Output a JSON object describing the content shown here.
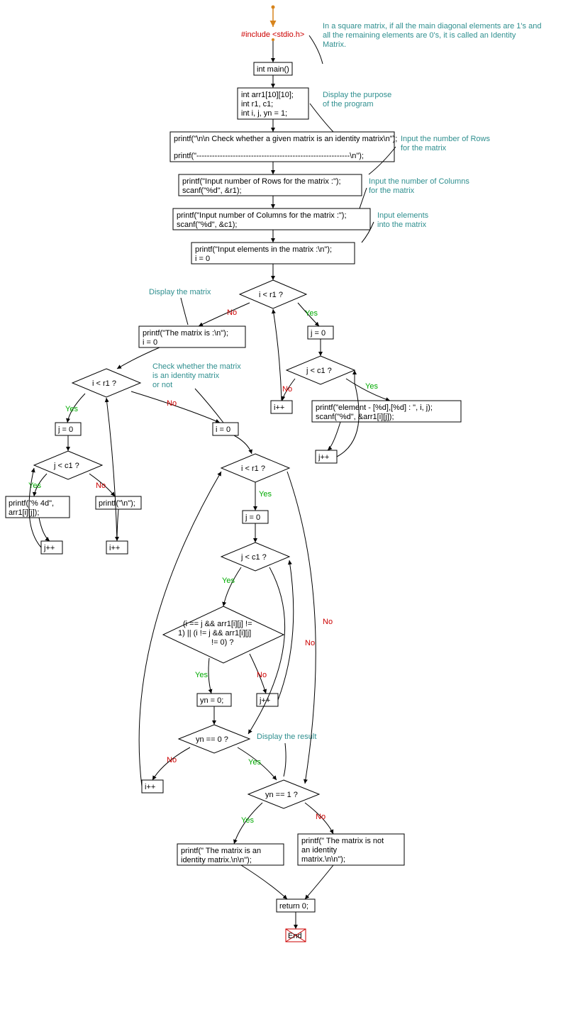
{
  "include": "#include <stdio.h>",
  "main_decl": "int main()",
  "decls_l1": "int arr1[10][10];",
  "decls_l2": "int r1, c1;",
  "decls_l3": "int i, j, yn = 1;",
  "print_header_l1": "printf(\"\\n\\n Check whether a given matrix is an identity matrix\\n\");",
  "print_header_l2": "printf(\"-----------------------------------------------------------\\n\");",
  "input_rows_l1": "printf(\"Input number of Rows for the matrix :\");",
  "input_rows_l2": "scanf(\"%d\", &r1);",
  "input_cols_l1": "printf(\"Input number of Columns for the matrix :\");",
  "input_cols_l2": "scanf(\"%d\", &c1);",
  "input_elems_l1": "printf(\"Input elements in the matrix :\\n\");",
  "input_elems_l2": "i = 0",
  "cond_i_lt_r1": "i < r1 ?",
  "j_eq_0": "j = 0",
  "cond_j_lt_c1": "j < c1 ?",
  "read_elem_l1": "printf(\"element - [%d],[%d] : \", i, j);",
  "read_elem_l2": "scanf(\"%d\", &arr1[i][j]);",
  "jpp": "j++",
  "ipp": "i++",
  "disp_matrix_l1": "printf(\"The matrix is :\\n\");",
  "disp_matrix_l2": "i = 0",
  "print_cell_l1": "printf(\"% 4d\",",
  "print_cell_l2": "arr1[i][j]);",
  "print_nl": "printf(\"\\n\");",
  "i_eq_0": "i = 0",
  "cond_identity_l1": "(i == j && arr1[i][j] !=",
  "cond_identity_l2": "1) || (i != j && arr1[i][j]",
  "cond_identity_l3": "!= 0) ?",
  "yn_eq_0": "yn = 0;",
  "cond_yn_eq_0": "yn == 0 ?",
  "cond_yn_eq_1": "yn == 1 ?",
  "res_yes_l1": "printf(\" The matrix is an",
  "res_yes_l2": "identity matrix.\\n\\n\");",
  "res_no_l1": "printf(\" The matrix is not",
  "res_no_l2": "an identity",
  "res_no_l3": "matrix.\\n\\n\");",
  "return0": "return 0;",
  "end": "End",
  "yes": "Yes",
  "no": "No",
  "c_top": "In a square matrix, if all the main diagonal elements are 1's and all the remaining elements are 0's, it is called an Identity Matrix.",
  "c_top_l1": "In a square matrix, if all the main diagonal elements are 1's and",
  "c_top_l2": "all the remaining elements are 0's, it is called an Identity",
  "c_top_l3": "Matrix.",
  "c_purpose_l1": "Display the purpose",
  "c_purpose_l2": "of the program",
  "c_rows_l1": "Input the number of Rows",
  "c_rows_l2": "for the matrix",
  "c_cols_l1": "Input the number of Columns",
  "c_cols_l2": "for the matrix",
  "c_elems_l1": "Input elements",
  "c_elems_l2": "into the matrix",
  "c_disp": "Display the matrix",
  "c_check_l1": "Check whether the matrix",
  "c_check_l2": "is an identity matrix",
  "c_check_l3": "or not",
  "c_result": "Display the result",
  "chart_data": {
    "type": "flowchart",
    "nodes": [
      {
        "id": "start_arrow",
        "type": "start"
      },
      {
        "id": "include",
        "type": "text",
        "text": "#include <stdio.h>"
      },
      {
        "id": "main",
        "type": "process",
        "text": "int main()"
      },
      {
        "id": "decls",
        "type": "process",
        "lines": [
          "int arr1[10][10];",
          "int r1, c1;",
          "int i, j, yn = 1;"
        ]
      },
      {
        "id": "print_header",
        "type": "process",
        "lines": [
          "printf(\"\\n\\n Check whether a given matrix is an identity matrix :\\n\");",
          "printf(\"-----------------------------------------------------------\\n\");"
        ]
      },
      {
        "id": "input_rows",
        "type": "process",
        "lines": [
          "printf(\"Input number of Rows for the matrix :\");",
          "scanf(\"%d\", &r1);"
        ]
      },
      {
        "id": "input_cols",
        "type": "process",
        "lines": [
          "printf(\"Input number of Columns for the matrix :\");",
          "scanf(\"%d\", &c1);"
        ]
      },
      {
        "id": "input_elems_init",
        "type": "process",
        "lines": [
          "printf(\"Input elements in the matrix :\\n\");",
          "i = 0"
        ]
      },
      {
        "id": "cond_i_r1_input",
        "type": "decision",
        "text": "i < r1 ?"
      },
      {
        "id": "j0_input",
        "type": "process",
        "text": "j = 0"
      },
      {
        "id": "cond_j_c1_input",
        "type": "decision",
        "text": "j < c1 ?"
      },
      {
        "id": "read_elem",
        "type": "process",
        "lines": [
          "printf(\"element - [%d],[%d] : \", i, j);",
          "scanf(\"%d\", &arr1[i][j]);"
        ]
      },
      {
        "id": "jpp_input",
        "type": "process",
        "text": "j++"
      },
      {
        "id": "ipp_input",
        "type": "process",
        "text": "i++"
      },
      {
        "id": "disp_init",
        "type": "process",
        "lines": [
          "printf(\"The matrix is :\\n\");",
          "i = 0"
        ]
      },
      {
        "id": "cond_i_r1_disp",
        "type": "decision",
        "text": "i < r1 ?"
      },
      {
        "id": "j0_disp",
        "type": "process",
        "text": "j = 0"
      },
      {
        "id": "cond_j_c1_disp",
        "type": "decision",
        "text": "j < c1 ?"
      },
      {
        "id": "print_cell",
        "type": "process",
        "lines": [
          "printf(\"% 4d\",",
          "arr1[i][j]);"
        ]
      },
      {
        "id": "jpp_disp",
        "type": "process",
        "text": "j++"
      },
      {
        "id": "print_nl",
        "type": "process",
        "text": "printf(\"\\n\");"
      },
      {
        "id": "ipp_disp",
        "type": "process",
        "text": "i++"
      },
      {
        "id": "i0_check",
        "type": "process",
        "text": "i = 0"
      },
      {
        "id": "cond_i_r1_check",
        "type": "decision",
        "text": "i < r1 ?"
      },
      {
        "id": "j0_check",
        "type": "process",
        "text": "j = 0"
      },
      {
        "id": "cond_j_c1_check",
        "type": "decision",
        "text": "j < c1 ?"
      },
      {
        "id": "cond_identity",
        "type": "decision",
        "text": "(i == j && arr1[i][j] != 1) || (i != j && arr1[i][j] != 0) ?"
      },
      {
        "id": "yn0",
        "type": "process",
        "text": "yn = 0;"
      },
      {
        "id": "jpp_check",
        "type": "process",
        "text": "j++"
      },
      {
        "id": "cond_yn0",
        "type": "decision",
        "text": "yn == 0 ?"
      },
      {
        "id": "ipp_check",
        "type": "process",
        "text": "i++"
      },
      {
        "id": "cond_yn1",
        "type": "decision",
        "text": "yn == 1 ?"
      },
      {
        "id": "res_yes",
        "type": "process",
        "text": "printf(\" The matrix is an identity matrix.\\n\\n\");"
      },
      {
        "id": "res_no",
        "type": "process",
        "text": "printf(\" The matrix is not an identity matrix.\\n\\n\");"
      },
      {
        "id": "return",
        "type": "process",
        "text": "return 0;"
      },
      {
        "id": "end",
        "type": "terminator",
        "text": "End"
      }
    ],
    "edges": [
      {
        "from": "start_arrow",
        "to": "include"
      },
      {
        "from": "include",
        "to": "main"
      },
      {
        "from": "main",
        "to": "decls"
      },
      {
        "from": "decls",
        "to": "print_header"
      },
      {
        "from": "print_header",
        "to": "input_rows"
      },
      {
        "from": "input_rows",
        "to": "input_cols"
      },
      {
        "from": "input_cols",
        "to": "input_elems_init"
      },
      {
        "from": "input_elems_init",
        "to": "cond_i_r1_input"
      },
      {
        "from": "cond_i_r1_input",
        "to": "j0_input",
        "label": "Yes"
      },
      {
        "from": "j0_input",
        "to": "cond_j_c1_input"
      },
      {
        "from": "cond_j_c1_input",
        "to": "read_elem",
        "label": "Yes"
      },
      {
        "from": "read_elem",
        "to": "jpp_input"
      },
      {
        "from": "jpp_input",
        "to": "cond_j_c1_input"
      },
      {
        "from": "cond_j_c1_input",
        "to": "ipp_input",
        "label": "No"
      },
      {
        "from": "ipp_input",
        "to": "cond_i_r1_input"
      },
      {
        "from": "cond_i_r1_input",
        "to": "disp_init",
        "label": "No"
      },
      {
        "from": "disp_init",
        "to": "cond_i_r1_disp"
      },
      {
        "from": "cond_i_r1_disp",
        "to": "j0_disp",
        "label": "Yes"
      },
      {
        "from": "j0_disp",
        "to": "cond_j_c1_disp"
      },
      {
        "from": "cond_j_c1_disp",
        "to": "print_cell",
        "label": "Yes"
      },
      {
        "from": "print_cell",
        "to": "jpp_disp"
      },
      {
        "from": "jpp_disp",
        "to": "cond_j_c1_disp"
      },
      {
        "from": "cond_j_c1_disp",
        "to": "print_nl",
        "label": "No"
      },
      {
        "from": "print_nl",
        "to": "ipp_disp"
      },
      {
        "from": "ipp_disp",
        "to": "cond_i_r1_disp"
      },
      {
        "from": "cond_i_r1_disp",
        "to": "i0_check",
        "label": "No"
      },
      {
        "from": "i0_check",
        "to": "cond_i_r1_check"
      },
      {
        "from": "cond_i_r1_check",
        "to": "j0_check",
        "label": "Yes"
      },
      {
        "from": "j0_check",
        "to": "cond_j_c1_check"
      },
      {
        "from": "cond_j_c1_check",
        "to": "cond_identity",
        "label": "Yes"
      },
      {
        "from": "cond_identity",
        "to": "yn0",
        "label": "Yes"
      },
      {
        "from": "cond_identity",
        "to": "jpp_check",
        "label": "No"
      },
      {
        "from": "yn0",
        "to": "cond_yn0"
      },
      {
        "from": "jpp_check",
        "to": "cond_j_c1_check"
      },
      {
        "from": "cond_j_c1_check",
        "to": "cond_yn0",
        "label": "No"
      },
      {
        "from": "cond_yn0",
        "to": "ipp_check",
        "label": "No"
      },
      {
        "from": "ipp_check",
        "to": "cond_i_r1_check"
      },
      {
        "from": "cond_yn0",
        "to": "cond_yn1",
        "label": "Yes"
      },
      {
        "from": "cond_i_r1_check",
        "to": "cond_yn1",
        "label": "No"
      },
      {
        "from": "cond_yn1",
        "to": "res_yes",
        "label": "Yes"
      },
      {
        "from": "cond_yn1",
        "to": "res_no",
        "label": "No"
      },
      {
        "from": "res_yes",
        "to": "return"
      },
      {
        "from": "res_no",
        "to": "return"
      },
      {
        "from": "return",
        "to": "end"
      }
    ],
    "annotations": [
      {
        "text": "In a square matrix, if all the main diagonal elements are 1's and all the remaining elements are 0's, it is called an Identity Matrix.",
        "attach": "include"
      },
      {
        "text": "Display the purpose of the program",
        "attach": "decls"
      },
      {
        "text": "Input the number of Rows for the matrix",
        "attach": "print_header"
      },
      {
        "text": "Input the number of Columns for the matrix",
        "attach": "input_rows"
      },
      {
        "text": "Input elements into the matrix",
        "attach": "input_cols"
      },
      {
        "text": "Display the matrix",
        "attach": "cond_i_r1_input"
      },
      {
        "text": "Check whether the matrix is an identity matrix or not",
        "attach": "cond_i_r1_disp"
      },
      {
        "text": "Display the result",
        "attach": "cond_yn0"
      }
    ]
  }
}
